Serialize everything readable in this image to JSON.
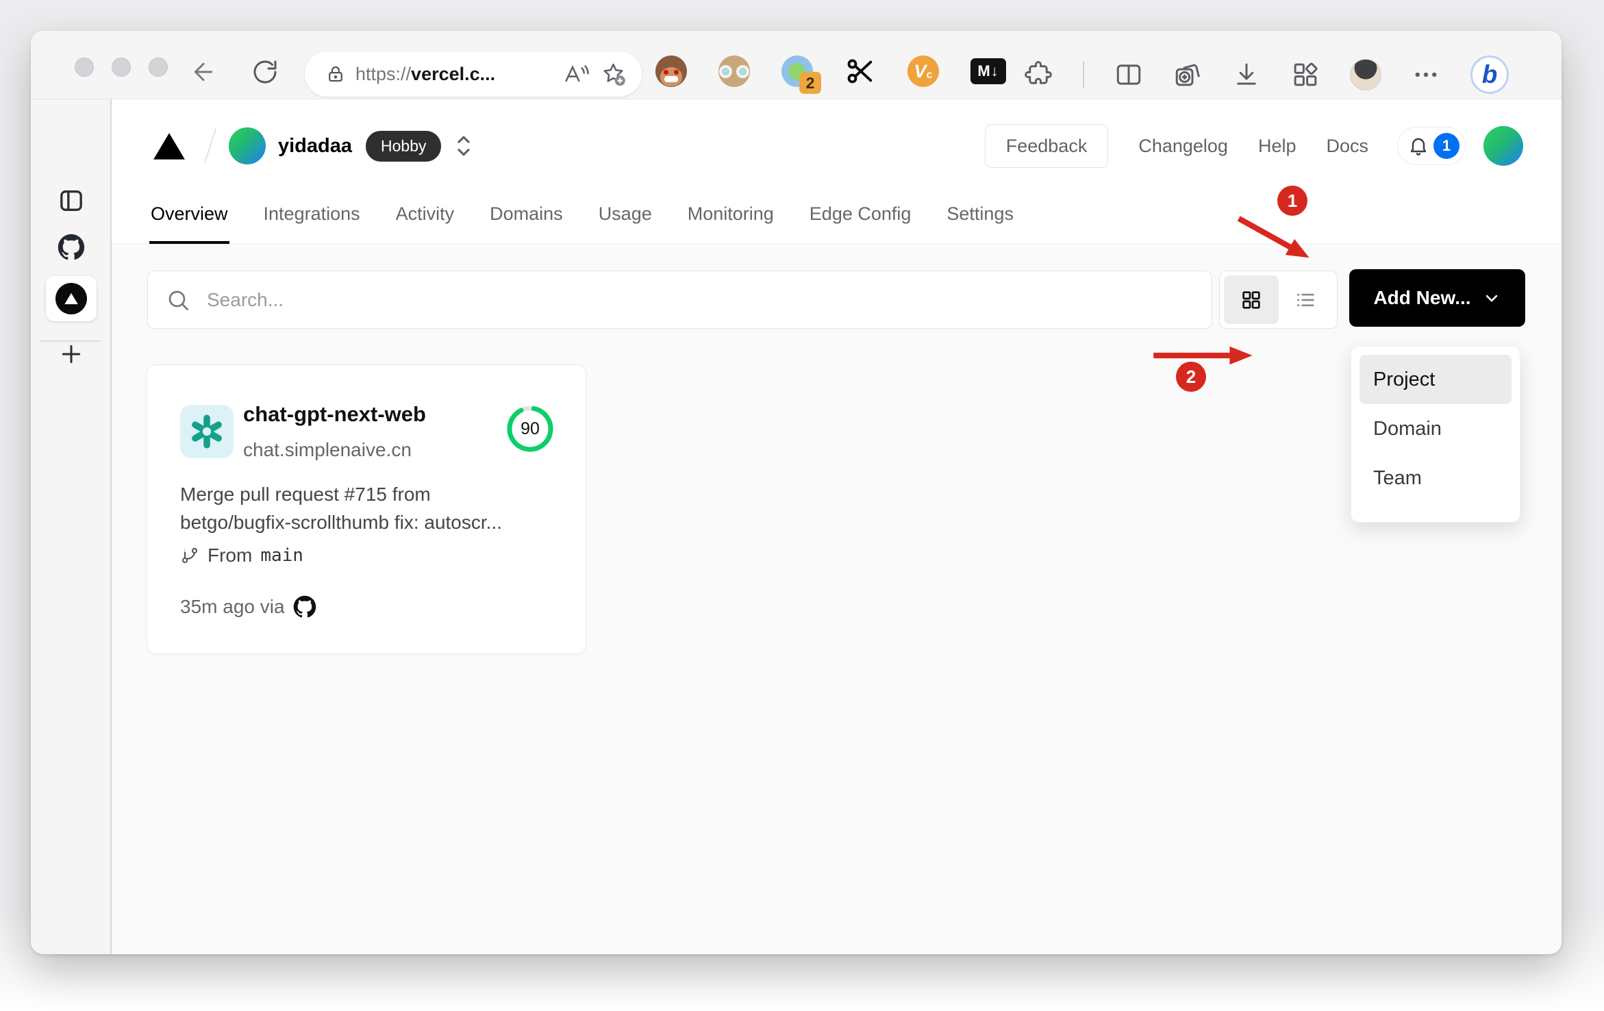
{
  "browser": {
    "url": {
      "scheme": "https://",
      "host": "vercel.c..."
    },
    "extension_badge": "2",
    "md_label": "M↓",
    "vc_label": "V",
    "vc_sub": "c",
    "bing_label": "b"
  },
  "workspace": {
    "team": "yidadaa",
    "plan": "Hobby"
  },
  "header": {
    "feedback": "Feedback",
    "links": [
      "Changelog",
      "Help",
      "Docs"
    ],
    "notifications": "1"
  },
  "nav": {
    "tabs": [
      "Overview",
      "Integrations",
      "Activity",
      "Domains",
      "Usage",
      "Monitoring",
      "Edge Config",
      "Settings"
    ]
  },
  "toolbar": {
    "search_placeholder": "Search...",
    "add_new": "Add New..."
  },
  "project": {
    "name": "chat-gpt-next-web",
    "domain": "chat.simplenaive.cn",
    "score": "90",
    "commit_lines": [
      "Merge pull request #715 from",
      "betgo/bugfix-scrollthumb fix: autoscr..."
    ],
    "branch_label": "From",
    "branch": "main",
    "deployed": "35m ago via"
  },
  "menu": {
    "items": [
      "Project",
      "Domain",
      "Team"
    ]
  },
  "annotations": {
    "steps": [
      "1",
      "2"
    ]
  },
  "colors": {
    "accent_red": "#d7281f",
    "vercel_blue": "#0070f3",
    "score_green": "#0cce6b",
    "openai_teal": "#16a08c"
  }
}
